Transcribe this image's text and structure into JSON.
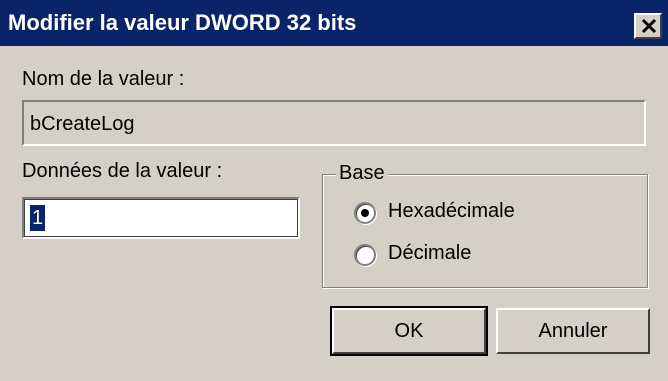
{
  "window": {
    "title": "Modifier la valeur DWORD 32 bits"
  },
  "fields": {
    "name_label": "Nom de la valeur :",
    "name_value": "bCreateLog",
    "data_label": "Données de la valeur :",
    "data_value": "1"
  },
  "base": {
    "title": "Base",
    "options": [
      {
        "label": "Hexadécimale",
        "selected": true
      },
      {
        "label": "Décimale",
        "selected": false
      }
    ]
  },
  "buttons": {
    "ok": "OK",
    "cancel": "Annuler"
  },
  "icons": {
    "close": "close-icon"
  },
  "colors": {
    "titlebar": "#0a246a",
    "face": "#d4d0c8",
    "selection": "#0a246a"
  }
}
